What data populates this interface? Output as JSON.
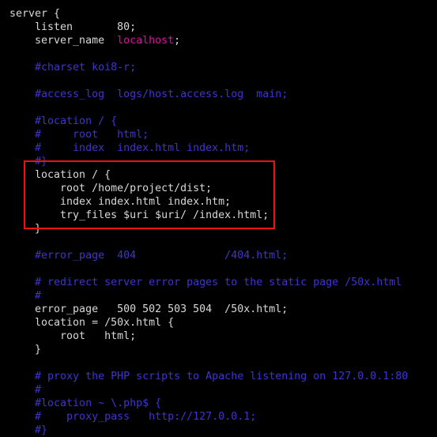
{
  "editor": {
    "background_color": "#000000",
    "default_text_color": "#d8d8d8",
    "comment_color": "#3f35cc",
    "string_color": "#d4179a",
    "highlight_border_color": "#ee1111",
    "lines": [
      {
        "indent": 0,
        "tokens": [
          {
            "t": "server {",
            "c": "default"
          }
        ]
      },
      {
        "indent": 0,
        "tokens": [
          {
            "t": "    listen       80;",
            "c": "default"
          }
        ]
      },
      {
        "indent": 0,
        "tokens": [
          {
            "t": "    server_name  ",
            "c": "default"
          },
          {
            "t": "localhost",
            "c": "string"
          },
          {
            "t": ";",
            "c": "default"
          }
        ]
      },
      {
        "indent": 0,
        "tokens": [
          {
            "t": " ",
            "c": "blank"
          }
        ]
      },
      {
        "indent": 0,
        "tokens": [
          {
            "t": "    #charset koi8-r;",
            "c": "comment"
          }
        ]
      },
      {
        "indent": 0,
        "tokens": [
          {
            "t": " ",
            "c": "blank"
          }
        ]
      },
      {
        "indent": 0,
        "tokens": [
          {
            "t": "    #access_log  logs/host.access.log  main;",
            "c": "comment"
          }
        ]
      },
      {
        "indent": 0,
        "tokens": [
          {
            "t": " ",
            "c": "blank"
          }
        ]
      },
      {
        "indent": 0,
        "tokens": [
          {
            "t": "    #location / {",
            "c": "comment"
          }
        ]
      },
      {
        "indent": 0,
        "tokens": [
          {
            "t": "    #     root   html;",
            "c": "comment"
          }
        ]
      },
      {
        "indent": 0,
        "tokens": [
          {
            "t": "    #     index  index.html index.htm;",
            "c": "comment"
          }
        ]
      },
      {
        "indent": 0,
        "tokens": [
          {
            "t": "    #}",
            "c": "comment"
          }
        ]
      },
      {
        "indent": 0,
        "tokens": [
          {
            "t": "    location / {",
            "c": "default"
          }
        ]
      },
      {
        "indent": 0,
        "tokens": [
          {
            "t": "        root /home/project/dist;",
            "c": "default"
          }
        ]
      },
      {
        "indent": 0,
        "tokens": [
          {
            "t": "        index index.html index.htm;",
            "c": "default"
          }
        ]
      },
      {
        "indent": 0,
        "tokens": [
          {
            "t": "        try_files $uri $uri/ /index.html;",
            "c": "default"
          }
        ]
      },
      {
        "indent": 0,
        "tokens": [
          {
            "t": "    }",
            "c": "default"
          }
        ]
      },
      {
        "indent": 0,
        "tokens": [
          {
            "t": " ",
            "c": "blank"
          }
        ]
      },
      {
        "indent": 0,
        "tokens": [
          {
            "t": "    #error_page  404              /404.html;",
            "c": "comment"
          }
        ]
      },
      {
        "indent": 0,
        "tokens": [
          {
            "t": " ",
            "c": "blank"
          }
        ]
      },
      {
        "indent": 0,
        "tokens": [
          {
            "t": "    # redirect server error pages to the static page /50x.html",
            "c": "comment"
          }
        ]
      },
      {
        "indent": 0,
        "tokens": [
          {
            "t": "    #",
            "c": "comment"
          }
        ]
      },
      {
        "indent": 0,
        "tokens": [
          {
            "t": "    error_page   500 502 503 504  /50x.html;",
            "c": "default"
          }
        ]
      },
      {
        "indent": 0,
        "tokens": [
          {
            "t": "    location = /50x.html {",
            "c": "default"
          }
        ]
      },
      {
        "indent": 0,
        "tokens": [
          {
            "t": "        root   html;",
            "c": "default"
          }
        ]
      },
      {
        "indent": 0,
        "tokens": [
          {
            "t": "    }",
            "c": "default"
          }
        ]
      },
      {
        "indent": 0,
        "tokens": [
          {
            "t": " ",
            "c": "blank"
          }
        ]
      },
      {
        "indent": 0,
        "tokens": [
          {
            "t": "    # proxy the PHP scripts to Apache listening on 127.0.0.1:80",
            "c": "comment"
          }
        ]
      },
      {
        "indent": 0,
        "tokens": [
          {
            "t": "    #",
            "c": "comment"
          }
        ]
      },
      {
        "indent": 0,
        "tokens": [
          {
            "t": "    #location ~ \\.php$ {",
            "c": "comment"
          }
        ]
      },
      {
        "indent": 0,
        "tokens": [
          {
            "t": "    #    proxy_pass   http://127.0.0.1;",
            "c": "comment"
          }
        ]
      },
      {
        "indent": 0,
        "tokens": [
          {
            "t": "    #}",
            "c": "comment"
          }
        ]
      }
    ],
    "highlight": {
      "label": "location-block-highlight",
      "covers_lines": [
        "location / {",
        "    root /home/project/dist;",
        "    index index.html index.htm;",
        "    try_files $uri $uri/ /index.html;",
        "}"
      ]
    }
  }
}
